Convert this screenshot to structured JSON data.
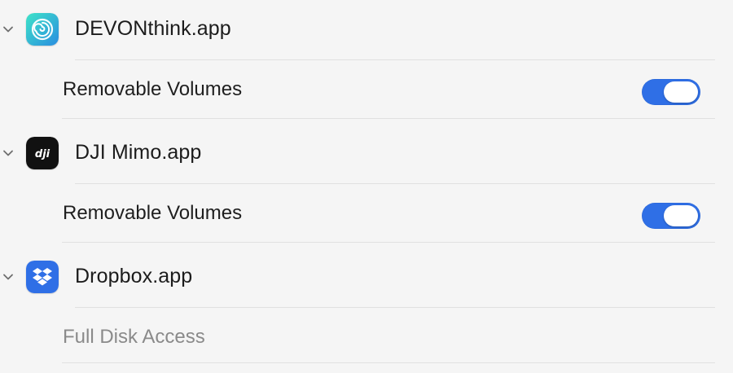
{
  "apps": [
    {
      "name": "DEVONthink.app",
      "icon": "devonthink-icon",
      "expanded": true,
      "permissions": [
        {
          "label": "Removable Volumes",
          "enabled": true,
          "toggle_on": true
        }
      ]
    },
    {
      "name": "DJI Mimo.app",
      "icon": "dji-icon",
      "expanded": true,
      "permissions": [
        {
          "label": "Removable Volumes",
          "enabled": true,
          "toggle_on": true
        }
      ]
    },
    {
      "name": "Dropbox.app",
      "icon": "dropbox-icon",
      "expanded": true,
      "permissions": [
        {
          "label": "Full Disk Access",
          "enabled": false
        }
      ]
    }
  ],
  "colors": {
    "toggle_on": "#2f6fe6",
    "divider": "#e0e0e0",
    "background": "#f5f5f5",
    "disabled_text": "#8a8a8a"
  }
}
